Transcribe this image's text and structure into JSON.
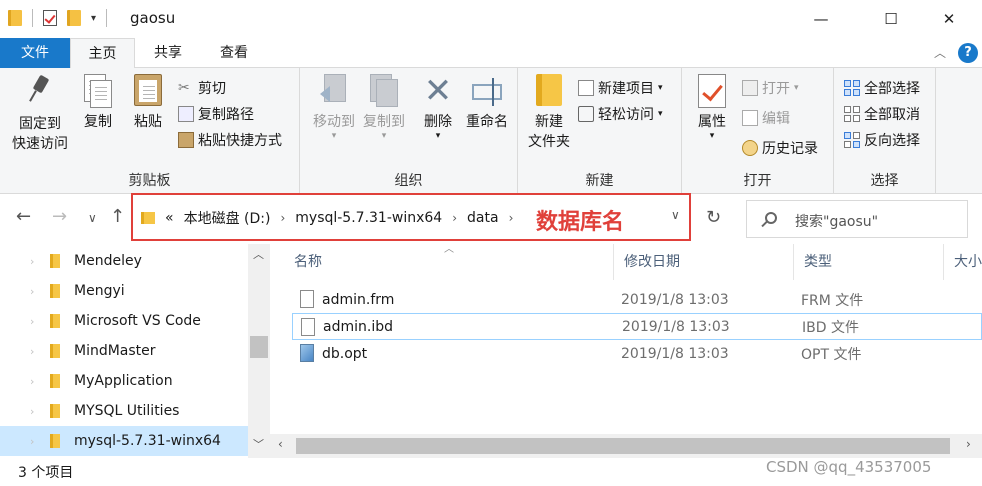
{
  "window": {
    "title": "gaosu",
    "minimize": "—",
    "maximize": "☐",
    "close": "✕"
  },
  "tabs": {
    "file": "文件",
    "home": "主页",
    "share": "共享",
    "view": "查看",
    "help": "?"
  },
  "ribbon": {
    "clipboard": {
      "label": "剪贴板",
      "pin_line1": "固定到",
      "pin_line2": "快速访问",
      "copy": "复制",
      "paste": "粘贴",
      "cut": "剪切",
      "copy_path": "复制路径",
      "paste_shortcut": "粘贴快捷方式"
    },
    "organize": {
      "label": "组织",
      "move_to": "移动到",
      "copy_to": "复制到",
      "delete": "删除",
      "rename": "重命名"
    },
    "new": {
      "label": "新建",
      "new_folder_line1": "新建",
      "new_folder_line2": "文件夹",
      "new_item": "新建项目",
      "easy_access": "轻松访问"
    },
    "open": {
      "label": "打开",
      "properties": "属性",
      "open": "打开",
      "edit": "编辑",
      "history": "历史记录"
    },
    "select": {
      "label": "选择",
      "select_all": "全部选择",
      "select_none": "全部取消",
      "invert": "反向选择"
    }
  },
  "address": {
    "overflow": "«",
    "crumbs": [
      "本地磁盘 (D:)",
      "mysql-5.7.31-winx64",
      "data"
    ],
    "annotation": "数据库名",
    "search_placeholder": "搜索\"gaosu\""
  },
  "nav_pane": {
    "items": [
      {
        "label": "Mendeley"
      },
      {
        "label": "Mengyi"
      },
      {
        "label": "Microsoft VS Code"
      },
      {
        "label": "MindMaster"
      },
      {
        "label": "MyApplication"
      },
      {
        "label": "MYSQL Utilities"
      },
      {
        "label": "mysql-5.7.31-winx64"
      }
    ]
  },
  "file_list": {
    "columns": {
      "name": "名称",
      "date": "修改日期",
      "type": "类型",
      "size": "大小"
    },
    "rows": [
      {
        "name": "admin.frm",
        "date": "2019/1/8 13:03",
        "type": "FRM 文件"
      },
      {
        "name": "admin.ibd",
        "date": "2019/1/8 13:03",
        "type": "IBD 文件"
      },
      {
        "name": "db.opt",
        "date": "2019/1/8 13:03",
        "type": "OPT 文件"
      }
    ]
  },
  "status": {
    "count": "3 个项目",
    "watermark": "CSDN @qq_43537005"
  },
  "colors": {
    "accent": "#1979ca",
    "annotation": "#e0403a",
    "selection": "#cce8ff"
  }
}
